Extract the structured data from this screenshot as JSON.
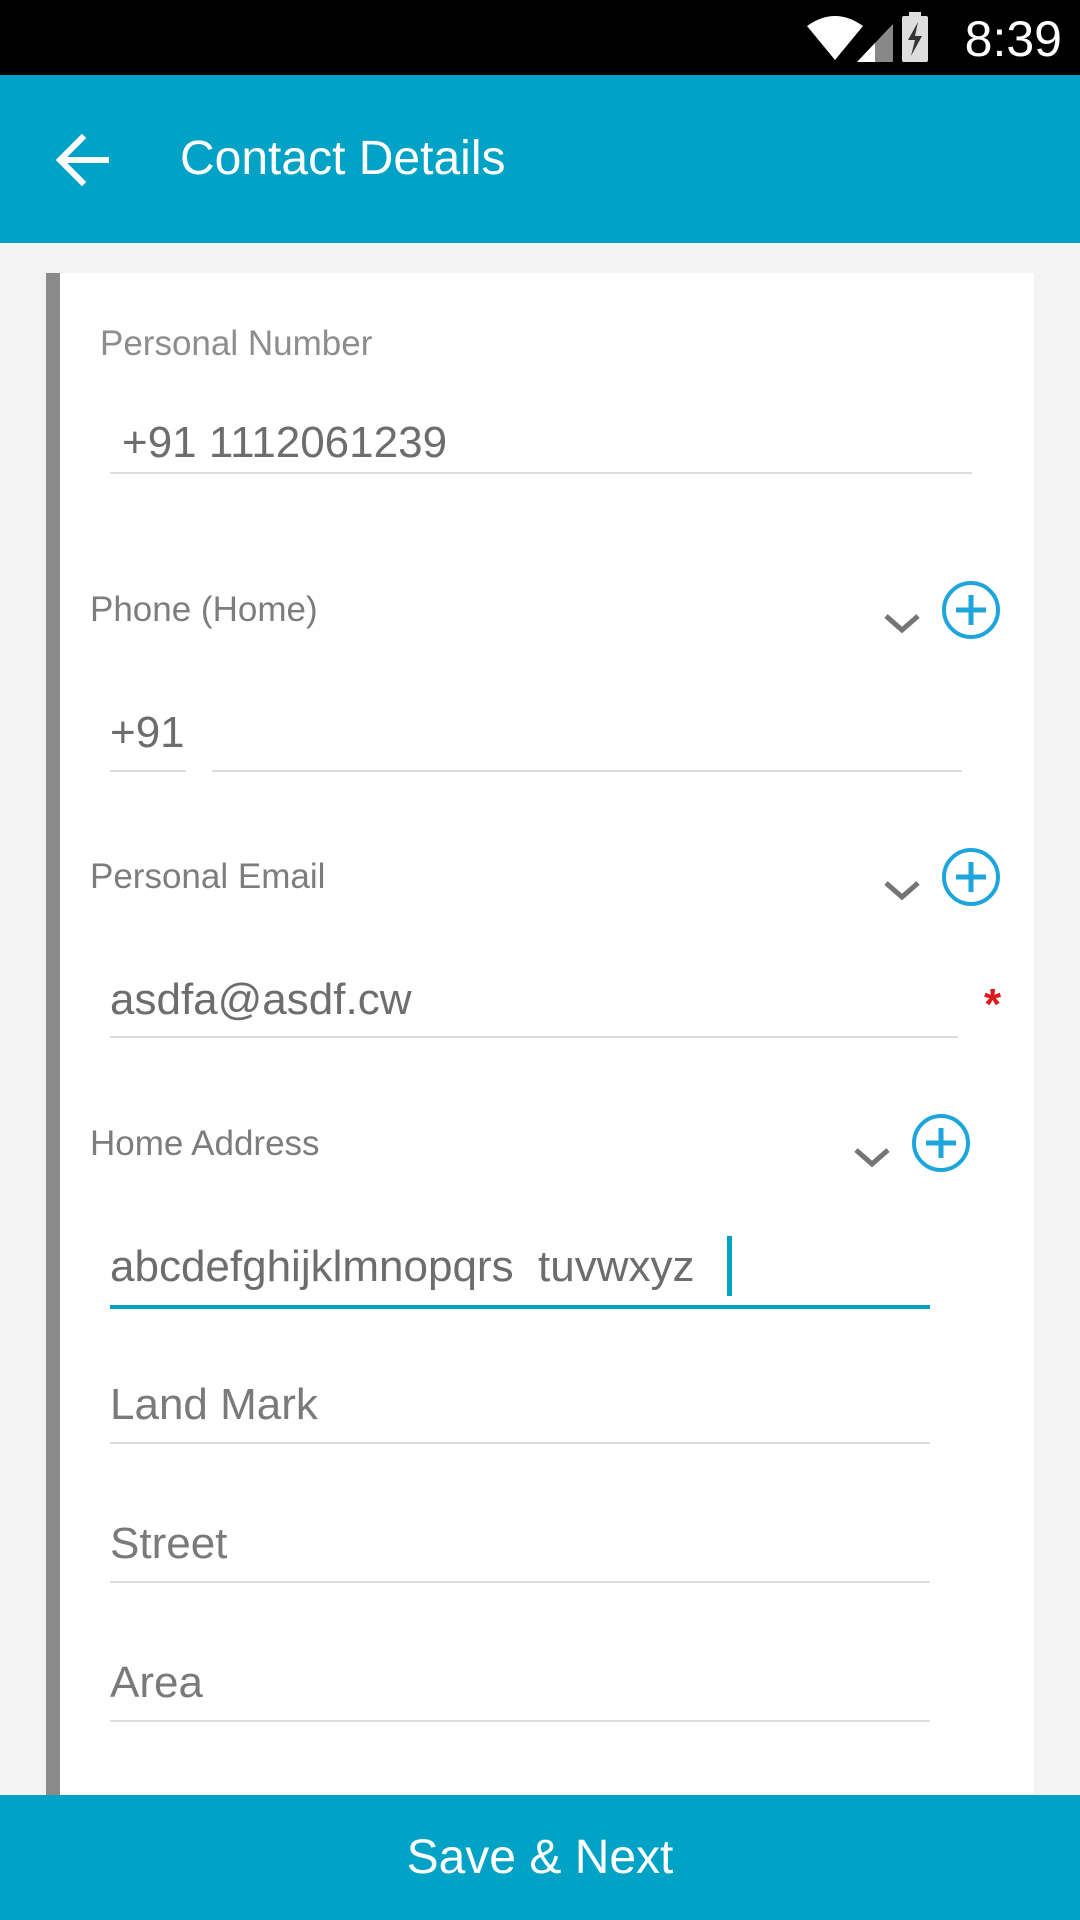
{
  "status_bar": {
    "time": "8:39",
    "icons": [
      "wifi-icon",
      "signal-icon",
      "battery-charging-icon"
    ]
  },
  "app_bar": {
    "title": "Contact Details",
    "back_icon": "arrow-left-icon"
  },
  "form": {
    "personal_number": {
      "label": "Personal Number",
      "value": "+91 1112061239"
    },
    "phone_home": {
      "label": "Phone (Home)",
      "country_code": "+91",
      "value": ""
    },
    "personal_email": {
      "label": "Personal Email",
      "value": "asdfa@asdf.cw",
      "required_mark": "*"
    },
    "home_address": {
      "label": "Home Address",
      "address_line": "abcdefghijklmnopqrs  tuvwxyz",
      "land_mark": "Land Mark",
      "street": "Street",
      "area": "Area"
    }
  },
  "footer": {
    "save_label": "Save & Next"
  },
  "colors": {
    "primary": "#00a2c6",
    "accent_icon": "#1ea6dc",
    "required": "#e0191b"
  }
}
